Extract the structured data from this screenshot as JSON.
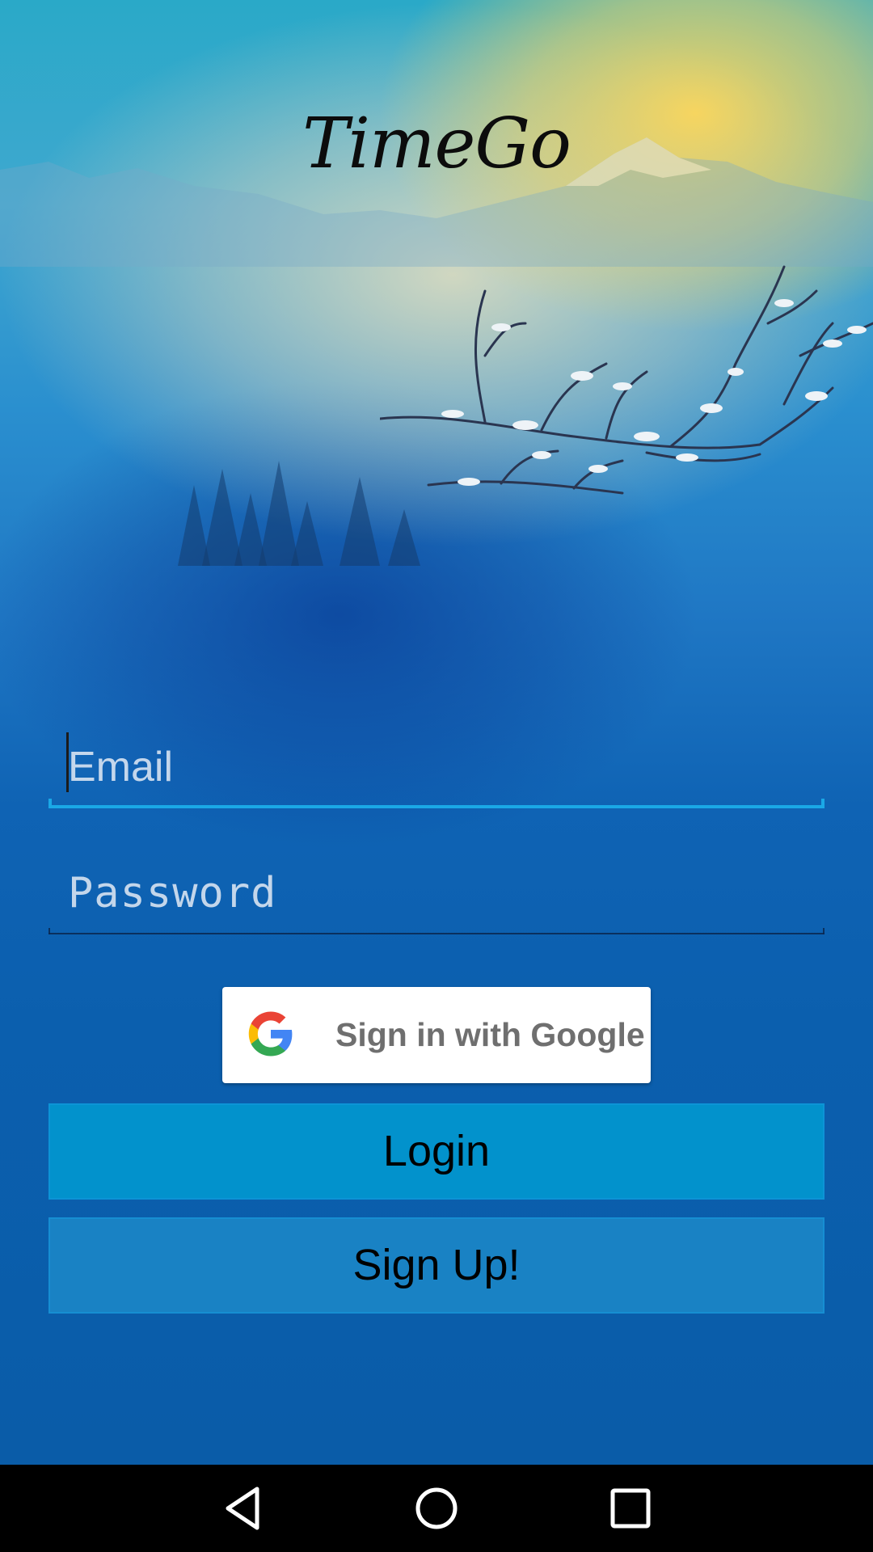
{
  "app": {
    "logo_text": "TimeGo"
  },
  "form": {
    "email_placeholder": "Email",
    "email_value": "",
    "password_placeholder": "Password",
    "password_value": ""
  },
  "buttons": {
    "google_label": "Sign in with Google",
    "login_label": "Login",
    "signup_label": "Sign Up!"
  },
  "icons": {
    "google": "google-g-icon",
    "back": "back-triangle-icon",
    "home": "home-circle-icon",
    "recents": "recents-square-icon"
  },
  "colors": {
    "login_button": "#0292cc",
    "signup_button": "#1982c4",
    "email_underline_focused": "#1aa8e6",
    "google_button_bg": "#ffffff",
    "google_label": "#6f6f6f",
    "navbar_bg": "#000000"
  }
}
